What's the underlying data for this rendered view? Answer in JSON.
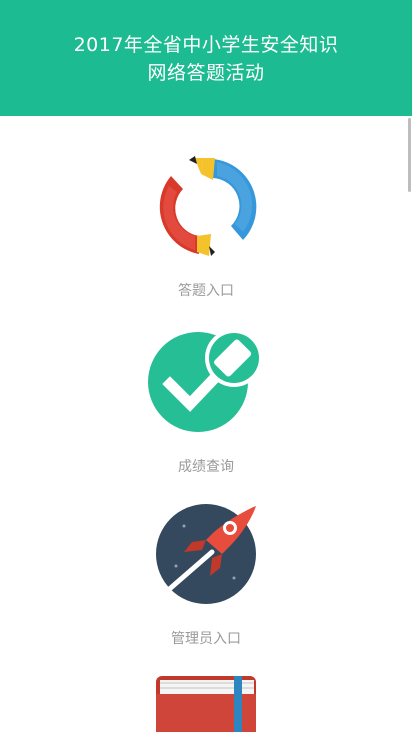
{
  "header": {
    "title_line1": "2017年全省中小学生安全知识",
    "title_line2": "网络答题活动",
    "background_color": "#1dbb91"
  },
  "menu": {
    "items": [
      {
        "label": "答题入口",
        "icon": "pencil-cycle-icon"
      },
      {
        "label": "成绩查询",
        "icon": "checkmark-eraser-icon"
      },
      {
        "label": "管理员入口",
        "icon": "rocket-icon"
      },
      {
        "label": "",
        "icon": "book-icon"
      }
    ]
  }
}
